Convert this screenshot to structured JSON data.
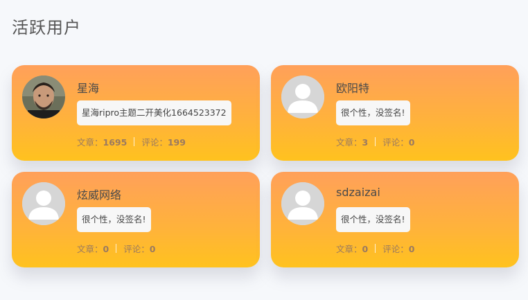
{
  "section_title": "活跃用户",
  "users": [
    {
      "name": "星海",
      "signature": "星海ripro主题二开美化1664523372",
      "posts_label": "文章：",
      "posts": "1695",
      "comments_label": "评论：",
      "comments": "199",
      "avatar": "photo-avatar"
    },
    {
      "name": "欧阳特",
      "signature": "很个性，没签名!",
      "posts_label": "文章：",
      "posts": "3",
      "comments_label": "评论：",
      "comments": "0",
      "avatar": "default-avatar"
    },
    {
      "name": "炫威网络",
      "signature": "很个性，没签名!",
      "posts_label": "文章：",
      "posts": "0",
      "comments_label": "评论：",
      "comments": "0",
      "avatar": "default-avatar"
    },
    {
      "name": "sdzaizai",
      "signature": "很个性，没签名!",
      "posts_label": "文章：",
      "posts": "0",
      "comments_label": "评论：",
      "comments": "0",
      "avatar": "default-avatar"
    }
  ]
}
